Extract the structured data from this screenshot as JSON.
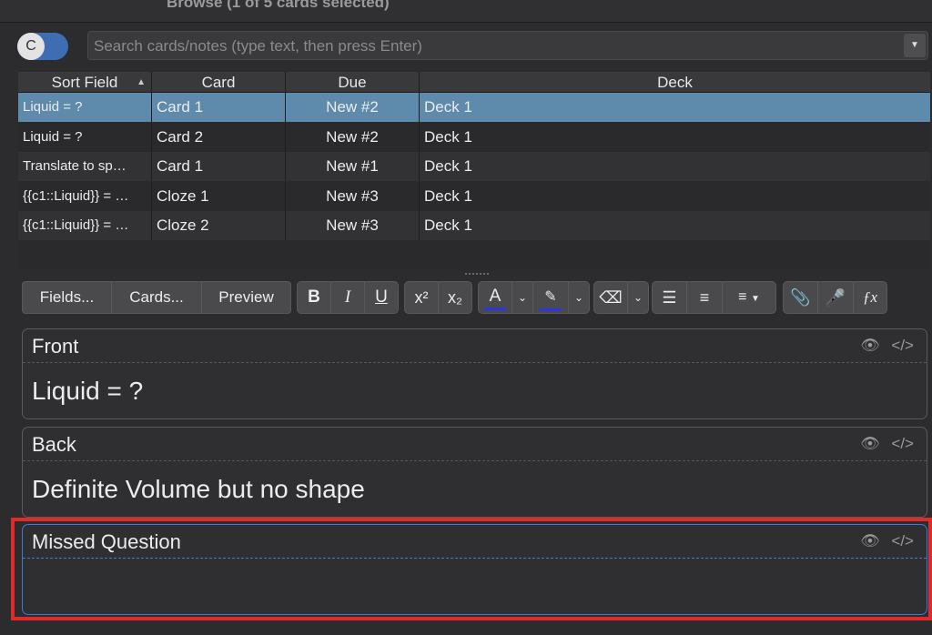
{
  "window": {
    "title": "Browse (1 of 5 cards selected)"
  },
  "toggle": {
    "label": "C"
  },
  "search": {
    "placeholder": "Search cards/notes (type text, then press Enter)",
    "value": ""
  },
  "table": {
    "headers": [
      "Sort Field",
      "Card",
      "Due",
      "Deck"
    ],
    "rows": [
      {
        "sort_field": "Liquid = ?",
        "card": "Card 1",
        "due": "New #2",
        "deck": "Deck 1",
        "selected": true
      },
      {
        "sort_field": "Liquid = ?",
        "card": "Card 2",
        "due": "New #2",
        "deck": "Deck 1",
        "selected": false
      },
      {
        "sort_field": "Translate to sp…",
        "card": "Card 1",
        "due": "New #1",
        "deck": "Deck 1",
        "selected": false
      },
      {
        "sort_field": "{{c1::Liquid}} = …",
        "card": "Cloze 1",
        "due": "New #3",
        "deck": "Deck 1",
        "selected": false
      },
      {
        "sort_field": "{{c1::Liquid}} = …",
        "card": "Cloze 2",
        "due": "New #3",
        "deck": "Deck 1",
        "selected": false
      }
    ]
  },
  "toolbar": {
    "fields_label": "Fields...",
    "cards_label": "Cards...",
    "preview_label": "Preview",
    "bold": "B",
    "italic": "I",
    "underline": "U",
    "text_color": "A"
  },
  "editor": {
    "fields": [
      {
        "name": "Front",
        "content": "Liquid = ?"
      },
      {
        "name": "Back",
        "content": "Definite Volume but no shape"
      },
      {
        "name": "Missed Question",
        "content": ""
      }
    ]
  },
  "colors": {
    "selected_row": "#5e8aac",
    "focus_border": "#3e7ad6",
    "highlight_box": "#e32a2a",
    "color_swatch": "#2a36e0"
  }
}
